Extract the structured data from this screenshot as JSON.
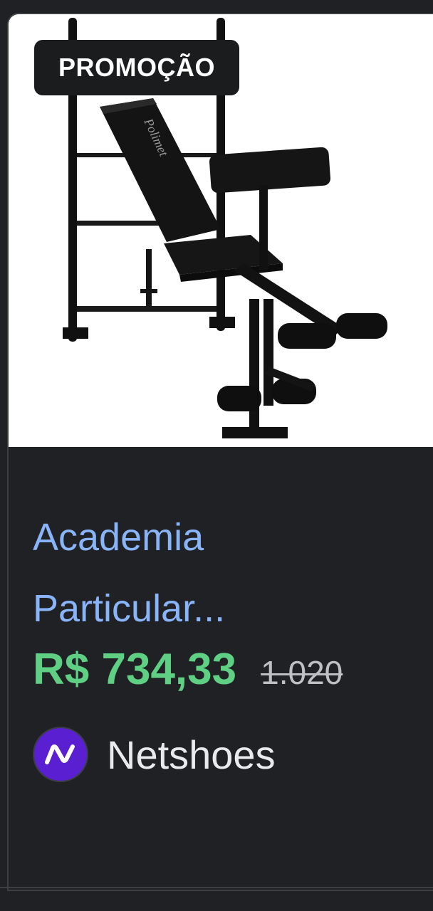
{
  "badge": {
    "label": "PROMOÇÃO"
  },
  "product": {
    "title": "Academia Particular...",
    "price": "R$ 734,33",
    "old_price": "1.020",
    "image_icon": "weight-bench-image",
    "bench_brand": "Polimet"
  },
  "store": {
    "name": "Netshoes",
    "logo_icon": "netshoes-logo-icon",
    "logo_color": "#5a1fd0"
  },
  "colors": {
    "title": "#8ab4f8",
    "price": "#5fcf83",
    "background": "#202124"
  }
}
